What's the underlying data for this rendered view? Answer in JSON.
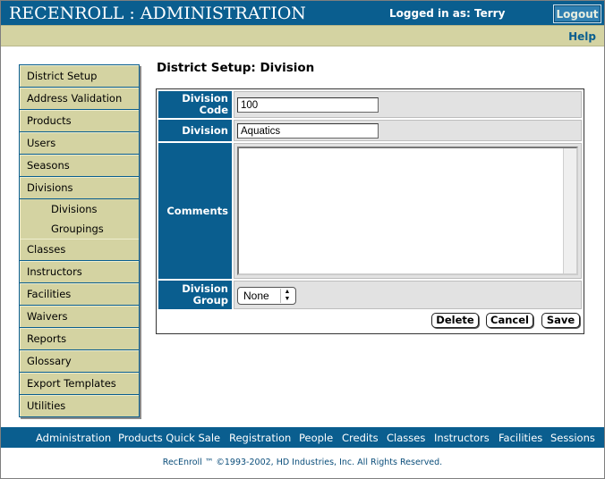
{
  "header": {
    "app_title": "RECENROLL : ADMINISTRATION",
    "logged_in": "Logged in as: Terry",
    "logout_label": "Logout"
  },
  "helpbar": {
    "help_label": "Help"
  },
  "sidebar": {
    "items": [
      {
        "label": "District Setup"
      },
      {
        "label": "Address Validation"
      },
      {
        "label": "Products"
      },
      {
        "label": "Users"
      },
      {
        "label": "Seasons"
      },
      {
        "label": "Divisions"
      },
      {
        "label": "Divisions",
        "sub": true
      },
      {
        "label": "Groupings",
        "sub": true
      },
      {
        "label": "Classes"
      },
      {
        "label": "Instructors"
      },
      {
        "label": "Facilities"
      },
      {
        "label": "Waivers"
      },
      {
        "label": "Reports"
      },
      {
        "label": "Glossary"
      },
      {
        "label": "Export Templates"
      },
      {
        "label": "Utilities"
      }
    ]
  },
  "main": {
    "page_title": "District Setup: Division",
    "form": {
      "division_code_label": "Division Code",
      "division_code_value": "100",
      "division_label": "Division",
      "division_value": "Aquatics",
      "comments_label": "Comments",
      "comments_value": "",
      "division_group_label": "Division Group",
      "division_group_selected": "None"
    },
    "buttons": {
      "delete_label": "Delete",
      "cancel_label": "Cancel",
      "save_label": "Save"
    }
  },
  "footer": {
    "links": [
      "Administration",
      "Products Quick Sale",
      "Registration",
      "People",
      "Credits",
      "Classes",
      "Instructors",
      "Facilities",
      "Sessions"
    ],
    "copyright": "RecEnroll ™ ©1993-2002, HD Industries, Inc.  All Rights Reserved."
  },
  "colors": {
    "primary_blue": "#0a5e8f",
    "khaki": "#d4d3a2",
    "field_gray": "#e2e2e2"
  }
}
